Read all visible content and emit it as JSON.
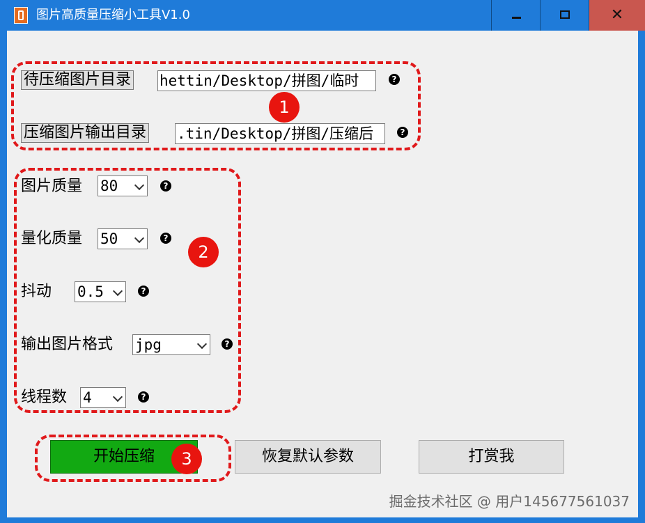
{
  "window": {
    "title": "图片高质量压缩小工具V1.0",
    "controls": {
      "minimize": "minimize",
      "maximize": "maximize",
      "close": "✕"
    }
  },
  "section1": {
    "badge": "1",
    "input_dir": {
      "button_label": "待压缩图片目录",
      "value": "hettin/Desktop/拼图/临时",
      "help": "?"
    },
    "output_dir": {
      "button_label": "压缩图片输出目录",
      "value": ".tin/Desktop/拼图/压缩后",
      "help": "?"
    }
  },
  "section2": {
    "badge": "2",
    "image_quality": {
      "label": "图片质量",
      "value": "80",
      "help": "?"
    },
    "quantize_quality": {
      "label": "量化质量",
      "value": "50",
      "help": "?"
    },
    "dither": {
      "label": "抖动",
      "value": "0.5",
      "help": "?"
    },
    "output_format": {
      "label": "输出图片格式",
      "value": "jpg",
      "help": "?"
    },
    "threads": {
      "label": "线程数",
      "value": "4",
      "help": "?"
    }
  },
  "actions": {
    "badge": "3",
    "start": "开始压缩",
    "reset": "恢复默认参数",
    "donate": "打赏我"
  },
  "watermark": "掘金技术社区 @ 用户145677561037",
  "colors": {
    "titlebar": "#1f7bd9",
    "close": "#c9574f",
    "start_button": "#12a912",
    "annotation": "#e0191b"
  }
}
